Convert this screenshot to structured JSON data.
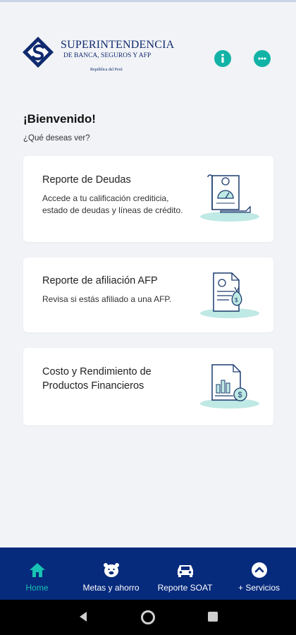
{
  "header": {
    "logo": {
      "title": "SUPERINTENDENCIA",
      "subtitle": "DE BANCA, SEGUROS Y AFP",
      "country": "República del Perú"
    },
    "info_icon": "info-icon",
    "chat_icon": "chat-icon",
    "accent_color": "#12b3a6"
  },
  "welcome": {
    "title": "¡Bienvenido!",
    "subtitle": "¿Qué deseas ver?"
  },
  "cards": [
    {
      "title": "Reporte de Deudas",
      "description": "Accede a tu calificación crediticia, estado de deudas y líneas de crédito.",
      "icon": "debt-report-icon"
    },
    {
      "title": "Reporte de afiliación AFP",
      "description": "Revisa si estás afiliado a una AFP.",
      "icon": "afp-document-icon"
    },
    {
      "title": "Costo y Rendimiento de Productos Financieros",
      "description": "",
      "icon": "financial-products-icon"
    }
  ],
  "bottom_nav": {
    "background": "#062a7c",
    "active_color": "#17c3b2",
    "items": [
      {
        "label": "Home",
        "icon": "home-icon",
        "active": true
      },
      {
        "label": "Metas y  ahorro",
        "icon": "piggy-bank-icon",
        "active": false
      },
      {
        "label": "Reporte SOAT",
        "icon": "car-icon",
        "active": false
      },
      {
        "label": "+ Servicios",
        "icon": "chevron-up-icon",
        "active": false
      }
    ]
  },
  "system_nav": {
    "back": "back-icon",
    "home": "home-circle-icon",
    "recents": "recents-icon"
  }
}
